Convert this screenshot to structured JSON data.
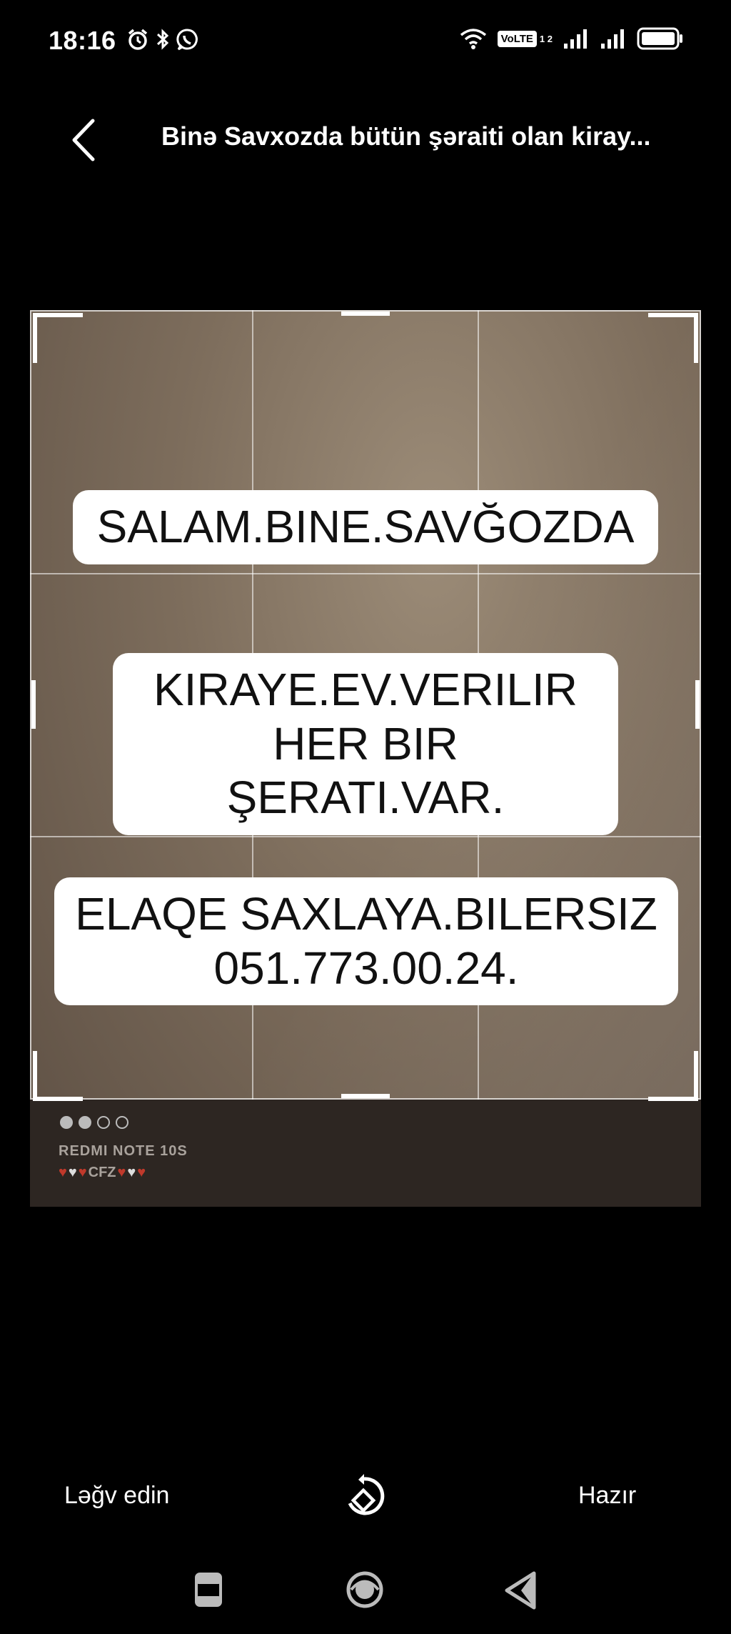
{
  "status_bar": {
    "time": "18:16",
    "left_icons": [
      "alarm-icon",
      "bluetooth-icon",
      "whatsapp-icon"
    ],
    "right_icons": [
      "wifi-icon",
      "volte-badge",
      "signal-icon",
      "signal-icon",
      "battery-icon"
    ],
    "volte_label": "VoLTE",
    "volte_sub": "1 2"
  },
  "header": {
    "back_icon": "chevron-left-icon",
    "title": "Binə Savxozda bütün şəraiti olan kiray..."
  },
  "photo": {
    "note1": "SALAM.BINE.SAVĞOZDA",
    "note2_line1": "KIRAYE.EV.VERILIR",
    "note2_line2": "HER BIR ŞERATI.VAR.",
    "note3_line1": "ELAQE SAXLAYA.BILERSIZ",
    "note3_line2": "051.773.00.24.",
    "watermark_model": "REDMI NOTE 10S",
    "watermark_sign": "CFZ"
  },
  "actions": {
    "cancel_label": "Ləğv edin",
    "rotate_icon": "rotate-icon",
    "done_label": "Hazır"
  },
  "nav": {
    "icons": [
      "recent-apps-icon",
      "home-icon",
      "back-icon"
    ]
  }
}
